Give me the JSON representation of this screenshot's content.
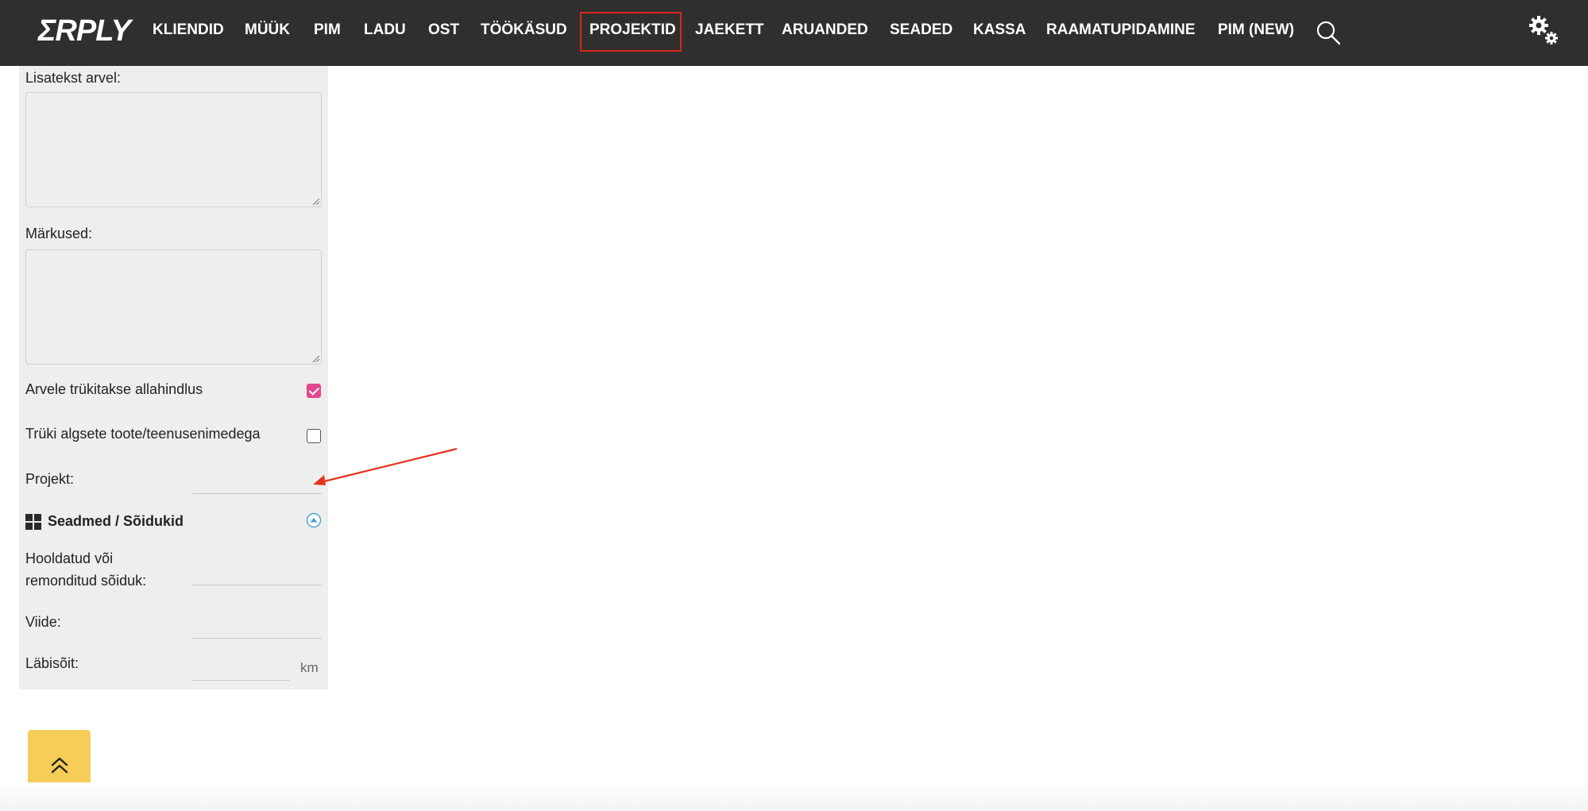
{
  "app": {
    "logo": "ΣRPLY"
  },
  "nav": {
    "items": [
      {
        "label": "KLIENDID"
      },
      {
        "label": "MÜÜK"
      },
      {
        "label": "PIM"
      },
      {
        "label": "LADU"
      },
      {
        "label": "OST"
      },
      {
        "label": "TÖÖKÄSUD"
      },
      {
        "label": "PROJEKTID",
        "active": true
      },
      {
        "label": "JAEKETT"
      },
      {
        "label": "ARUANDED"
      },
      {
        "label": "SEADED"
      },
      {
        "label": "KASSA"
      },
      {
        "label": "RAAMATUPIDAMINE"
      },
      {
        "label": "PIM (NEW)"
      }
    ],
    "search_icon": "search-icon",
    "settings_icon": "gear-icon"
  },
  "form": {
    "extra_text_label": "Lisatekst arvel:",
    "extra_text_value": "",
    "notes_label": "Märkused:",
    "notes_value": "",
    "discount_label": "Arvele trükitakse allahindlus",
    "discount_checked": true,
    "original_names_label": "Trüki algsete toote/teenusenimedega",
    "original_names_checked": false,
    "project_label": "Projekt:",
    "project_value": ""
  },
  "devices": {
    "title": "Seadmed / Sõidukid",
    "vehicle_label_line1": "Hooldatud või",
    "vehicle_label_line2": "remonditud sõiduk:",
    "vehicle_value": "",
    "reference_label": "Viide:",
    "reference_value": "",
    "mileage_label": "Läbisõit:",
    "mileage_value": "",
    "mileage_unit": "km"
  },
  "colors": {
    "topbar": "#2f2f2f",
    "active_outline": "#d9261c",
    "checkbox_checked": "#e4468e",
    "scroll_button": "#f5cd57",
    "annotation_arrow": "#e3341f"
  }
}
